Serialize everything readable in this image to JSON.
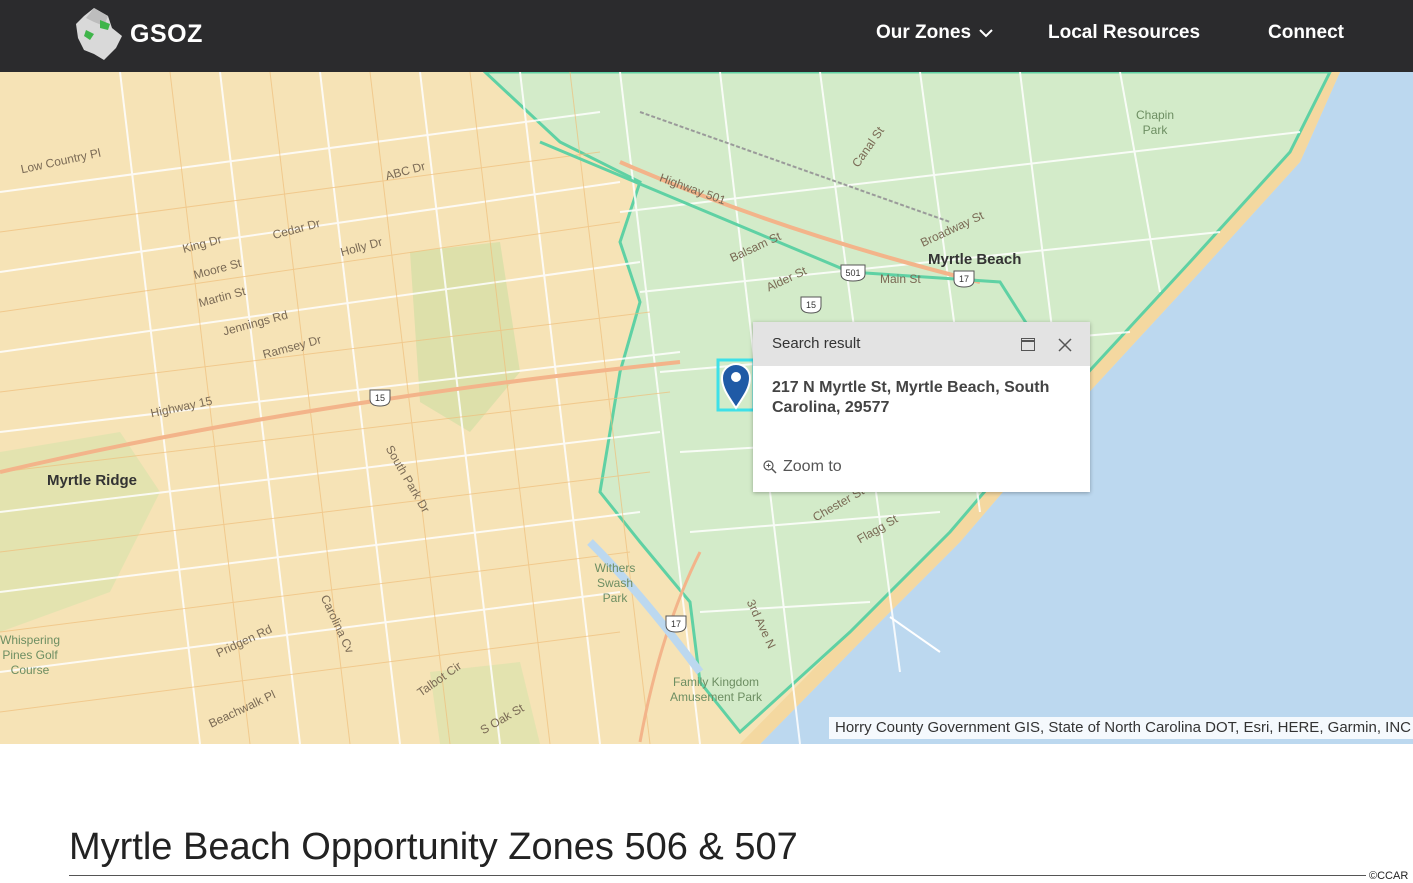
{
  "header": {
    "logo_text": "GSOZ",
    "logo_icon": "county-map-logo-icon",
    "nav": {
      "zones_label": "Our Zones",
      "zones_icon": "chevron-down-icon",
      "resources_label": "Local Resources",
      "connect_label": "Connect"
    }
  },
  "map": {
    "labels": {
      "myrtle_ridge": "Myrtle Ridge",
      "myrtle_beach": "Myrtle Beach",
      "withers_swash_park": "Withers Swash Park",
      "family_kingdom": "Family Kingdom Amusement Park",
      "whispering_pines": "Whispering Pines Golf Course",
      "chapin_park": "Chapin Park"
    },
    "streets": {
      "low_country": "Low Country Pl",
      "abc": "ABC Dr",
      "cedar": "Cedar Dr",
      "holly": "Holly Dr",
      "king": "King Dr",
      "moore": "Moore St",
      "martin": "Martin St",
      "jennings": "Jennings Rd",
      "ramsey": "Ramsey Dr",
      "highway15": "Highway 15",
      "highway501": "Highway 501",
      "south_park": "South Park Dr",
      "main": "Main St",
      "broadway": "Broadway St",
      "alder": "Alder St",
      "balsam": "Balsam St",
      "chester": "Chester St",
      "flagg": "Flagg St",
      "oak": "S Oak St",
      "pridgen": "Pridgen Rd",
      "beachwalk": "Beachwalk Pl",
      "carolina": "Carolina Cv",
      "talbot": "Talbot Cir",
      "canal": "Canal St",
      "third_ave": "3rd Ave N"
    },
    "shields": {
      "s15a": "15",
      "s15b": "15",
      "s17a": "17",
      "s17b": "17",
      "s501": "501"
    },
    "attribution": "Horry County Government GIS, State of North Carolina DOT, Esri, HERE, Garmin, INC",
    "colors": {
      "base": "#f6e3b6",
      "zone_fill": "#cdeccd",
      "zone_border": "#5fd1a4",
      "water": "#bcd8ef",
      "highlight": "#3ee0e8",
      "pin": "#1f5aa6"
    }
  },
  "popup": {
    "title": "Search result",
    "address": "217 N Myrtle St, Myrtle Beach, South Carolina, 29577",
    "zoom_label": "Zoom to",
    "icons": [
      "maximize-icon",
      "close-icon",
      "zoom-in-icon"
    ]
  },
  "page": {
    "title": "Myrtle Beach Opportunity Zones 506 & 507",
    "copyright": "©CCAR"
  }
}
